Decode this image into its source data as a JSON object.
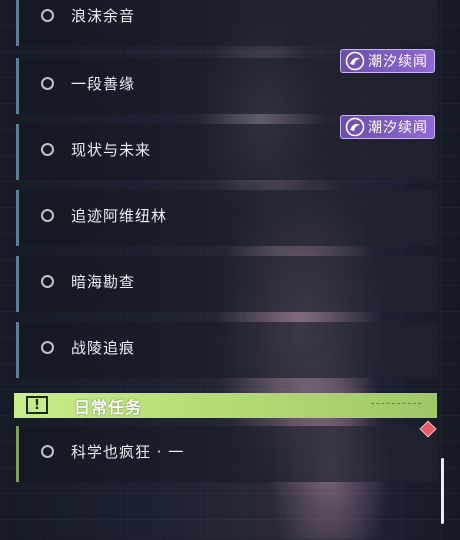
{
  "quests": [
    {
      "label": "浪沫余音"
    },
    {
      "label": "一段善缘",
      "badge": "潮汐续闻"
    },
    {
      "label": "现状与未来",
      "badge": "潮汐续闻"
    },
    {
      "label": "追迹阿维纽林"
    },
    {
      "label": "暗海勘查"
    },
    {
      "label": "战陵追痕"
    }
  ],
  "daily_section": {
    "title": "日常任务",
    "icon": "alert-icon"
  },
  "daily_quests": [
    {
      "label": "科学也疯狂 · 一",
      "marker": "red-diamond"
    }
  ],
  "colors": {
    "section_bar": "#c8ed8a",
    "badge": "#7d5cc2",
    "quest_border": "#5d7d92",
    "daily_border": "#7da05e",
    "marker": "#e05a6a"
  }
}
